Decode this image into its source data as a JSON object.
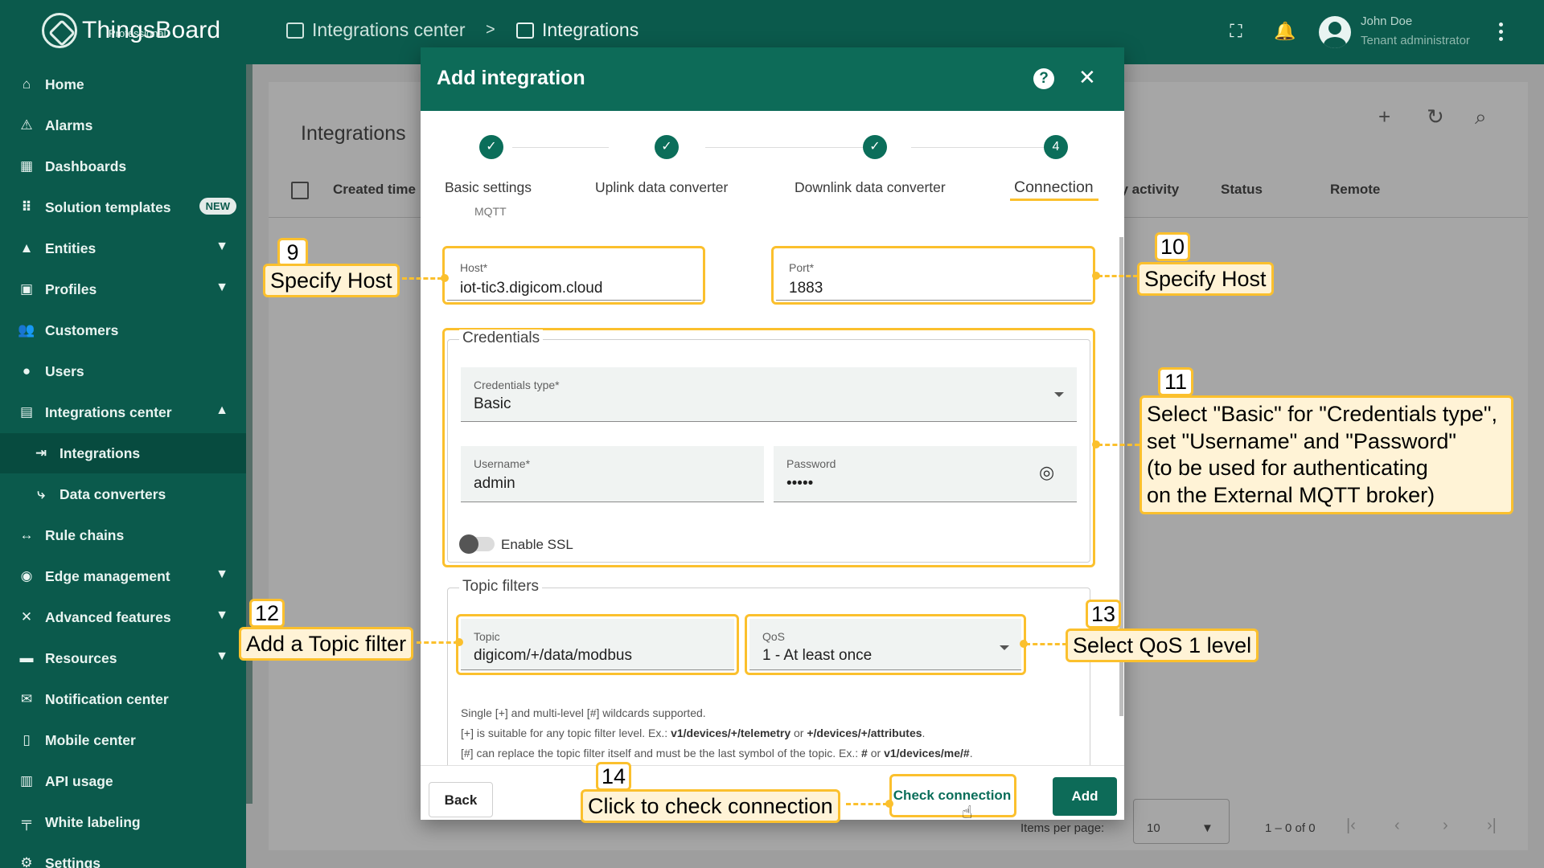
{
  "app": {
    "name": "ThingsBoard",
    "edition": "Professional"
  },
  "breadcrumb": {
    "parent": "Integrations center",
    "separator": ">",
    "current": "Integrations"
  },
  "user": {
    "name": "John Doe",
    "role": "Tenant administrator"
  },
  "sidebar": {
    "items": [
      {
        "label": "Home",
        "icon": "home-icon"
      },
      {
        "label": "Alarms",
        "icon": "alarm-icon"
      },
      {
        "label": "Dashboards",
        "icon": "dashboard-icon"
      },
      {
        "label": "Solution templates",
        "icon": "grid-icon",
        "badge": "NEW"
      },
      {
        "label": "Entities",
        "icon": "entities-icon"
      },
      {
        "label": "Profiles",
        "icon": "profiles-icon"
      },
      {
        "label": "Customers",
        "icon": "customers-icon"
      },
      {
        "label": "Users",
        "icon": "user-icon"
      },
      {
        "label": "Integrations center",
        "icon": "integrations-center-icon"
      },
      {
        "label": "Integrations",
        "icon": "integrations-icon"
      },
      {
        "label": "Data converters",
        "icon": "converters-icon"
      },
      {
        "label": "Rule chains",
        "icon": "rule-chain-icon"
      },
      {
        "label": "Edge management",
        "icon": "edge-icon"
      },
      {
        "label": "Advanced features",
        "icon": "tools-icon"
      },
      {
        "label": "Resources",
        "icon": "folder-icon"
      },
      {
        "label": "Notification center",
        "icon": "notification-icon"
      },
      {
        "label": "Mobile center",
        "icon": "mobile-icon"
      },
      {
        "label": "API usage",
        "icon": "chart-icon"
      },
      {
        "label": "White labeling",
        "icon": "brush-icon"
      },
      {
        "label": "Settings",
        "icon": "gear-icon"
      }
    ]
  },
  "page": {
    "title": "Integrations",
    "columns": [
      "Created time",
      "ily activity",
      "Status",
      "Remote"
    ],
    "items_per_page_label": "Items per page:",
    "items_per_page": "10",
    "range": "1 – 0 of 0"
  },
  "dialog": {
    "title": "Add integration",
    "steps": [
      {
        "label": "Basic settings",
        "sub": "MQTT",
        "state": "✓"
      },
      {
        "label": "Uplink data converter",
        "state": "✓"
      },
      {
        "label": "Downlink data converter",
        "state": "✓"
      },
      {
        "label": "Connection",
        "state": "4"
      }
    ],
    "host": {
      "label": "Host*",
      "value": "iot-tic3.digicom.cloud"
    },
    "port": {
      "label": "Port*",
      "value": "1883"
    },
    "credentials": {
      "legend": "Credentials",
      "type_label": "Credentials type*",
      "type_value": "Basic",
      "username_label": "Username*",
      "username_value": "admin",
      "password_label": "Password",
      "password_value": "•••••",
      "ssl_label": "Enable SSL"
    },
    "topic_filters": {
      "legend": "Topic filters",
      "topic_label": "Topic",
      "topic_value": "digicom/+/data/modbus",
      "qos_label": "QoS",
      "qos_value": "1 - At least once",
      "hint1": "Single [+] and multi-level [#] wildcards supported.",
      "hint2a": "[+] is suitable for any topic filter level. Ex.: ",
      "hint2b": "v1/devices/+/telemetry",
      "hint2c": " or ",
      "hint2d": "+/devices/+/attributes",
      "hint2e": ".",
      "hint3a": "[#] can replace the topic filter itself and must be the last symbol of the topic. Ex.: ",
      "hint3b": "#",
      "hint3c": " or ",
      "hint3d": "v1/devices/me/#",
      "hint3e": "."
    },
    "buttons": {
      "back": "Back",
      "check": "Check connection",
      "add": "Add"
    }
  },
  "annotations": [
    {
      "num": "9",
      "text": "Specify Host"
    },
    {
      "num": "10",
      "text": "Specify Host"
    },
    {
      "num": "11",
      "lines": [
        "Select \"Basic\" for \"Credentials type\",",
        "set \"Username\" and \"Password\"",
        "(to be used for authenticating",
        "on the External MQTT broker)"
      ]
    },
    {
      "num": "12",
      "text": "Add a Topic filter"
    },
    {
      "num": "13",
      "text": "Select QoS 1 level"
    },
    {
      "num": "14",
      "text": "Click to check connection"
    }
  ],
  "colors": {
    "primary": "#0b5a4c",
    "accent": "#fbc02d",
    "header": "#0d6b58"
  }
}
